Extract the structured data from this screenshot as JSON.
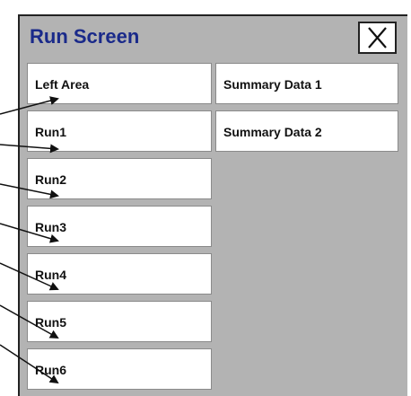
{
  "window": {
    "title": "Run Screen",
    "close_icon": "close-x-icon"
  },
  "left_buttons": [
    {
      "label": "Left Area"
    },
    {
      "label": "Run1"
    },
    {
      "label": "Run2"
    },
    {
      "label": "Run3"
    },
    {
      "label": "Run4"
    },
    {
      "label": "Run5"
    },
    {
      "label": "Run6"
    }
  ],
  "right_buttons": [
    {
      "label": "Summary Data 1"
    },
    {
      "label": "Summary Data 2"
    }
  ],
  "colors": {
    "panel_background": "#b3b3b3",
    "title_text": "#1a2a8a",
    "arrow": "#111111"
  }
}
